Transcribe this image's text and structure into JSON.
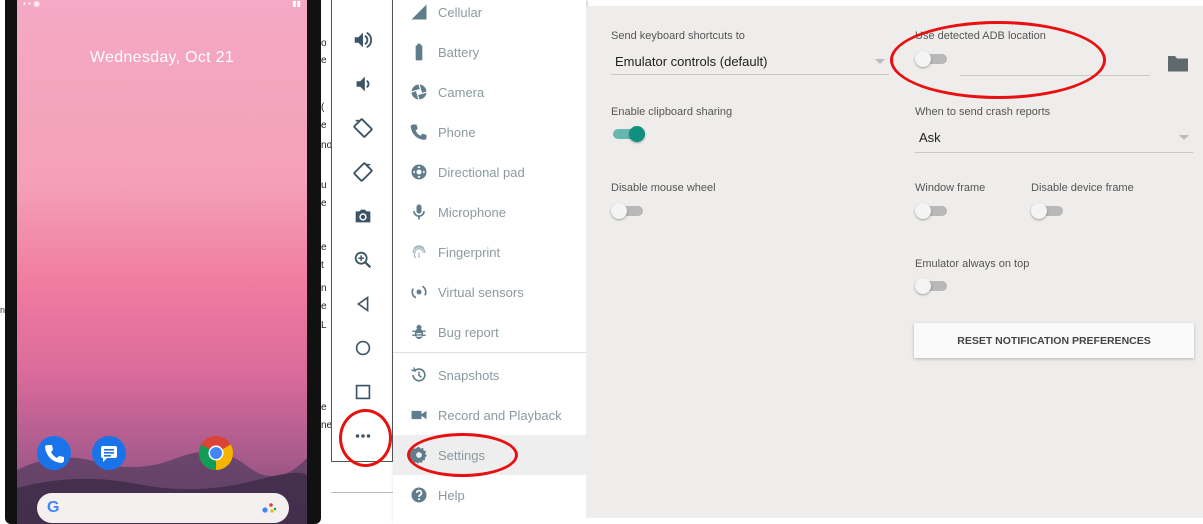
{
  "phone": {
    "date": "Wednesday, Oct 21",
    "google_letter": "G"
  },
  "toolbar": {
    "buttons": [
      {
        "name": "volume-up",
        "icon": "volume-up-icon"
      },
      {
        "name": "volume-down",
        "icon": "volume-down-icon"
      },
      {
        "name": "rotate-left",
        "icon": "rotate-left-icon"
      },
      {
        "name": "rotate-right",
        "icon": "rotate-right-icon"
      },
      {
        "name": "screenshot",
        "icon": "camera-icon"
      },
      {
        "name": "zoom",
        "icon": "zoom-in-icon"
      },
      {
        "name": "back",
        "icon": "back-triangle-icon"
      },
      {
        "name": "home",
        "icon": "home-circle-icon"
      },
      {
        "name": "overview",
        "icon": "overview-square-icon"
      },
      {
        "name": "more",
        "icon": "more-dots-icon"
      }
    ]
  },
  "menu": {
    "items": [
      {
        "label": "Cellular",
        "icon": "cellular-icon"
      },
      {
        "label": "Battery",
        "icon": "battery-icon"
      },
      {
        "label": "Camera",
        "icon": "camera-aperture-icon"
      },
      {
        "label": "Phone",
        "icon": "phone-icon"
      },
      {
        "label": "Directional pad",
        "icon": "dpad-icon"
      },
      {
        "label": "Microphone",
        "icon": "microphone-icon"
      },
      {
        "label": "Fingerprint",
        "icon": "fingerprint-icon"
      },
      {
        "label": "Virtual sensors",
        "icon": "virtual-sensors-icon"
      },
      {
        "label": "Bug report",
        "icon": "bug-icon"
      },
      {
        "label": "Snapshots",
        "icon": "snapshots-icon"
      },
      {
        "label": "Record and Playback",
        "icon": "video-camera-icon"
      },
      {
        "label": "Settings",
        "icon": "gear-icon"
      },
      {
        "label": "Help",
        "icon": "help-icon"
      }
    ],
    "active": "Settings"
  },
  "settings": {
    "keyboard_shortcuts": {
      "label": "Send keyboard shortcuts to",
      "value": "Emulator controls (default)"
    },
    "use_adb": {
      "label": "Use detected ADB location",
      "on": false
    },
    "clipboard": {
      "label": "Enable clipboard sharing",
      "on": true
    },
    "crash_reports": {
      "label": "When to send crash reports",
      "value": "Ask"
    },
    "mouse_wheel": {
      "label": "Disable mouse wheel",
      "on": false
    },
    "window_frame": {
      "label": "Window frame",
      "on": false
    },
    "device_frame": {
      "label": "Disable device frame",
      "on": false
    },
    "always_on_top": {
      "label": "Emulator always on top",
      "on": false
    },
    "reset_button": "RESET NOTIFICATION PREFERENCES"
  },
  "colors": {
    "annotation": "#e81010",
    "toggle_on": "#11907f",
    "panel_bg": "#eeedeb",
    "icon": "#607d8b"
  }
}
